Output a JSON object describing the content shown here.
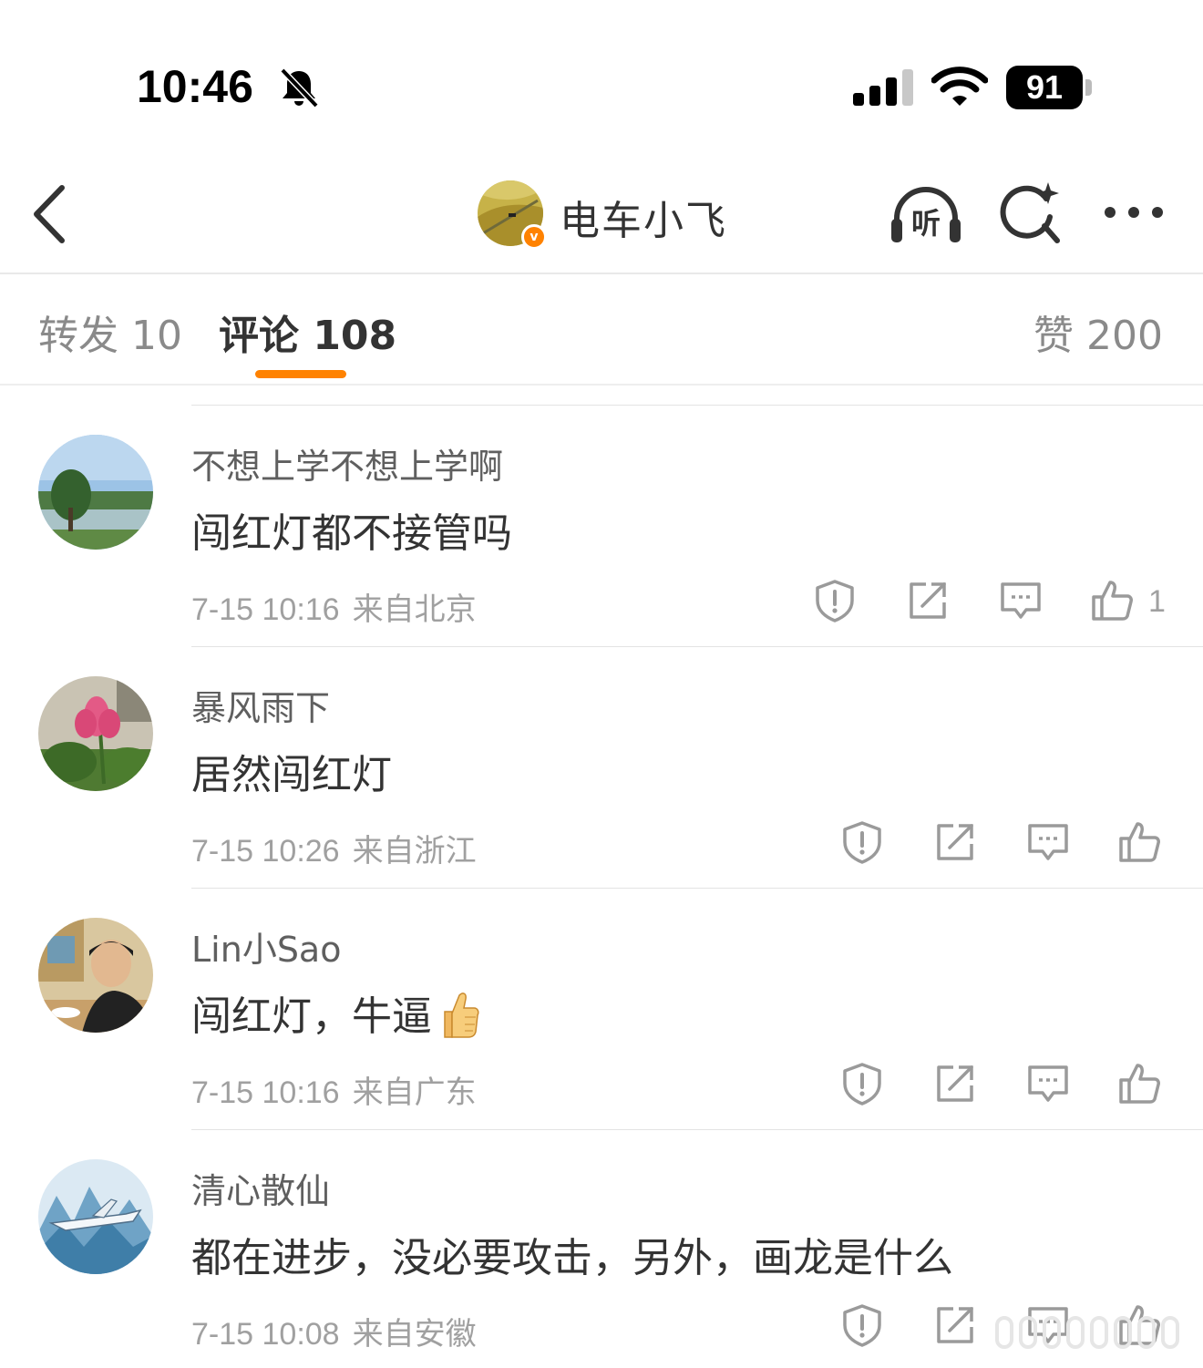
{
  "status_bar": {
    "time": "10:46",
    "battery": "91",
    "icons": [
      "bell-mute-icon",
      "signal-icon",
      "wifi-icon",
      "battery-icon"
    ]
  },
  "nav": {
    "back_icon": "chevron-left-icon",
    "title": "电车小飞",
    "verified_badge": "v",
    "listen_label": "听",
    "actions": [
      "listen-icon",
      "ai-search-icon",
      "more-icon"
    ]
  },
  "tabs": {
    "repost": "转发 10",
    "comments": "评论 108",
    "likes": "赞 200",
    "active": "comments",
    "accent": "#ff8200"
  },
  "comments": [
    {
      "user": "不想上学不想上学啊",
      "text": "闯红灯都不接管吗",
      "time": "7-15 10:16",
      "location": "来自北京",
      "likes": "1"
    },
    {
      "user": "暴风雨下",
      "text": "居然闯红灯",
      "time": "7-15 10:26",
      "location": "来自浙江",
      "likes": ""
    },
    {
      "user": "Lin小Sao",
      "text": "闯红灯，牛逼",
      "emoji": "thumbs-up",
      "time": "7-15 10:16",
      "location": "来自广东",
      "likes": ""
    },
    {
      "user": "清心散仙",
      "text": "都在进步，没必要攻击，另外，画龙是什么",
      "time": "7-15 10:08",
      "location": "来自安徽",
      "likes": ""
    }
  ]
}
